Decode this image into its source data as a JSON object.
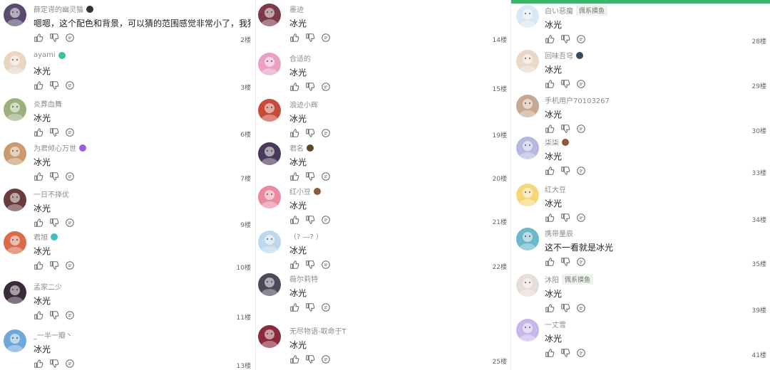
{
  "columns": [
    {
      "comments": [
        {
          "avatar_color": "#5a4a6e",
          "username": "薛定谔的幽灵猫",
          "badge_color": "#333333",
          "text": "嗯嗯，这个配色和背景，可以猜的范围感觉非常小了，我猜是冰",
          "floor": "2楼"
        },
        {
          "avatar_color": "#e8d5c4",
          "username": "ayami",
          "badge_color": "#3fbf9c",
          "text": "冰光",
          "floor": "3楼"
        },
        {
          "avatar_color": "#9cb07e",
          "username": "炎葬血舞",
          "badge_color": "",
          "text": "冰光",
          "floor": "6楼"
        },
        {
          "avatar_color": "#c89a6e",
          "username": "为君倾心万世",
          "badge_color": "#9b5de5",
          "text": "冰光",
          "floor": "7楼"
        },
        {
          "avatar_color": "#6b3a3a",
          "username": "一日不择优",
          "badge_color": "",
          "text": "冰光",
          "floor": "9楼"
        },
        {
          "avatar_color": "#d96a4a",
          "username": "君旭",
          "badge_color": "#3fbfbf",
          "text": "冰光",
          "floor": "10楼"
        },
        {
          "avatar_color": "#3a2a3a",
          "username": "孟家二少",
          "badge_color": "",
          "text": "冰光",
          "floor": "11楼"
        },
        {
          "avatar_color": "#6fa8d8",
          "username": "_一半一瓣丶",
          "badge_color": "",
          "text": "冰光",
          "floor": "13楼"
        }
      ]
    },
    {
      "comments": [
        {
          "avatar_color": "#7a3a4a",
          "username": "墨迹",
          "badge_color": "",
          "text": "冰光",
          "floor": "14楼"
        },
        {
          "avatar_color": "#e9a0c4",
          "username": "合适的",
          "badge_color": "",
          "text": "冰光",
          "floor": "15楼"
        },
        {
          "avatar_color": "#c84a3a",
          "username": "浪迹小辉",
          "badge_color": "",
          "text": "冰光",
          "floor": "19楼"
        },
        {
          "avatar_color": "#4a3a5a",
          "username": "君名",
          "badge_color": "#5a4a2a",
          "text": "冰光",
          "floor": "20楼"
        },
        {
          "avatar_color": "#e88aa0",
          "username": "红小豆",
          "badge_color": "#8a5a3a",
          "text": "冰光",
          "floor": "21楼"
        },
        {
          "avatar_color": "#bcd8ec",
          "username": "（? —? ）",
          "badge_color": "",
          "text": "冰光",
          "floor": "22楼"
        },
        {
          "avatar_color": "#4a4a5a",
          "username": "薇尔莉特",
          "badge_color": "",
          "text": "冰光",
          "floor": ""
        },
        {
          "avatar_color": "#8a2a3a",
          "username": "无尽物语-取命于T",
          "badge_color": "",
          "text": "冰光",
          "floor": "25楼"
        }
      ]
    },
    {
      "comments": [
        {
          "avatar_color": "#d8e8f4",
          "username": "白い惡魔",
          "tag": "佩系摸鱼",
          "badge_color": "",
          "text": "冰光",
          "floor": "28楼"
        },
        {
          "avatar_color": "#e8d8c8",
          "username": "回味吾穹",
          "badge_color": "#3a4a5a",
          "text": "冰光",
          "floor": "29楼"
        },
        {
          "avatar_color": "#c8a890",
          "username": "手机用户70103267",
          "badge_color": "",
          "text": "冰光",
          "floor": "30楼"
        },
        {
          "avatar_color": "#b8b8e0",
          "username": "柒柒",
          "badge_color": "#8a5a3a",
          "text": "冰光",
          "floor": "33楼"
        },
        {
          "avatar_color": "#f4d878",
          "username": "红大豆",
          "badge_color": "",
          "text": "冰光",
          "floor": "34楼"
        },
        {
          "avatar_color": "#6ab8c8",
          "username": "携带量辰",
          "badge_color": "",
          "text": "这不一看就是冰光",
          "floor": "35楼"
        },
        {
          "avatar_color": "#e8dcd8",
          "username": "沐阳",
          "tag": "佩系摸鱼",
          "badge_color": "",
          "text": "冰光",
          "floor": "39楼"
        },
        {
          "avatar_color": "#c8b8e8",
          "username": "一丈雪",
          "badge_color": "",
          "text": "冰光",
          "floor": "41楼"
        }
      ]
    }
  ],
  "colors": {
    "accent": "#3bb36b",
    "muted": "#8c8c8c",
    "icon": "#6b6b6b"
  },
  "icons": {
    "like": "thumb-up-icon",
    "dislike": "thumb-down-icon",
    "reply": "reply-bubble-icon"
  }
}
